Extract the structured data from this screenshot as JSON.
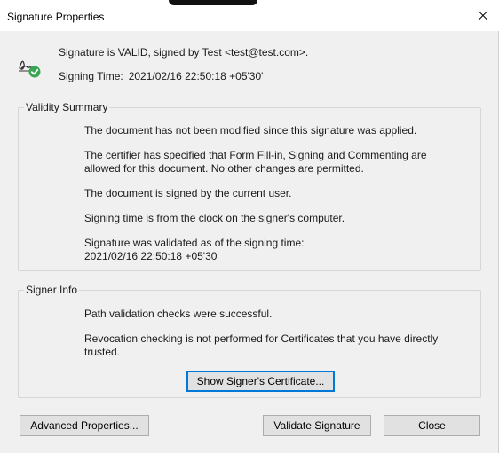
{
  "window": {
    "title": "Signature Properties"
  },
  "header": {
    "status": "Signature is VALID, signed by Test <test@test.com>.",
    "signing_time_label": "Signing Time:",
    "signing_time_value": "2021/02/16 22:50:18 +05'30'",
    "icon": "signature-valid-icon"
  },
  "validity_summary": {
    "label": "Validity Summary",
    "items": [
      "The document has not been modified since this signature was applied.",
      "The certifier has specified that Form Fill-in, Signing and Commenting are allowed for this document. No other changes are permitted.",
      "The document is signed by the current user.",
      "Signing time is from the clock on the signer's computer.",
      "Signature was validated as of the signing time:",
      "2021/02/16 22:50:18 +05'30'"
    ]
  },
  "signer_info": {
    "label": "Signer Info",
    "items": [
      "Path validation checks were successful.",
      "Revocation checking is not performed for Certificates that you have directly trusted."
    ],
    "show_certificate_label": "Show Signer's Certificate..."
  },
  "footer": {
    "advanced_label": "Advanced Properties...",
    "validate_label": "Validate Signature",
    "close_label": "Close"
  },
  "colors": {
    "dialog_bg": "#f0f0f0",
    "focus_border": "#0078d7",
    "valid_check": "#3aa655"
  }
}
